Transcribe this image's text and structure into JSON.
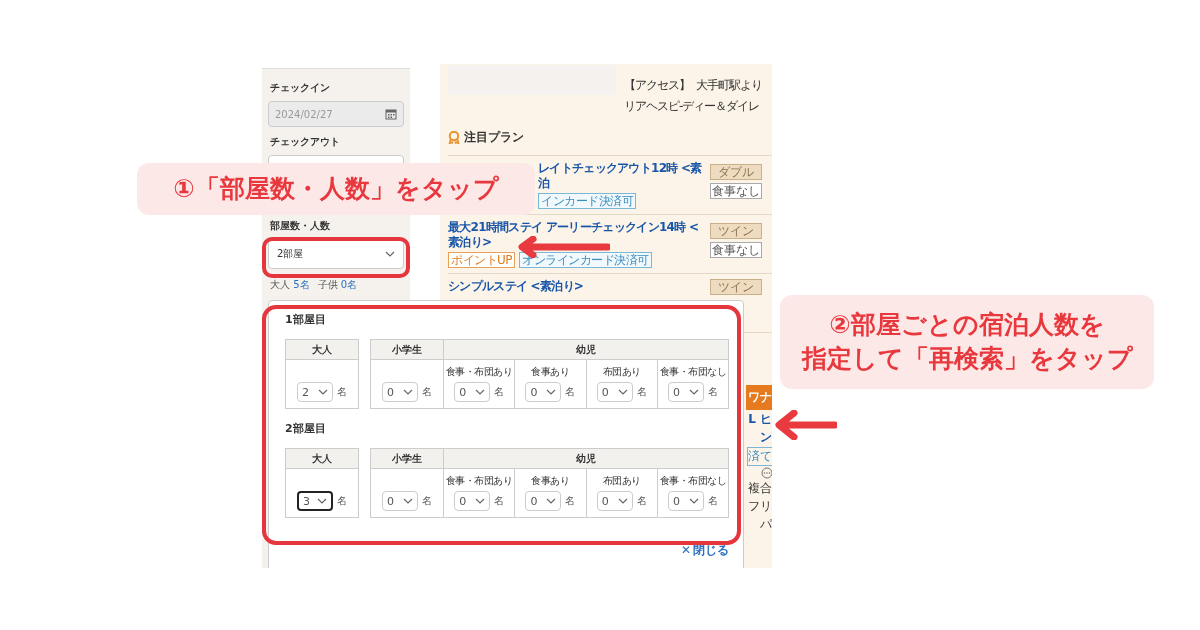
{
  "sidebar": {
    "checkin_label": "チェックイン",
    "checkin_field": {
      "value": "2024/02/27",
      "disabled": true
    },
    "checkout_label": "チェックアウト",
    "rooms_label": "部屋数・人数",
    "rooms_select": "2部屋",
    "summary": [
      {
        "label": "大人",
        "count": "5名"
      },
      {
        "label": "子供",
        "count": "0名"
      }
    ]
  },
  "main": {
    "access_label": "【アクセス】",
    "access_lines": [
      "大手町駅より",
      "リアヘスピ-ディー＆ダイレ"
    ],
    "featured_title": "注目プラン",
    "plans": [
      {
        "title": "レイトチェックアウト12時 <素泊",
        "tags": [
          {
            "text": "インカード決済可",
            "kind": "payment"
          }
        ],
        "room_type": "ダブル",
        "meal": "食事なし"
      },
      {
        "title": "最大21時間ステイ アーリーチェックイン14時 <素泊り>",
        "tags": [
          {
            "text": "ポイントUP",
            "kind": "point"
          },
          {
            "text": "オンラインカード決済可",
            "kind": "payment"
          }
        ],
        "room_type": "ツイン",
        "meal": "食事なし"
      },
      {
        "title": "シンプルステイ <素泊り>",
        "room_type": "ツイン"
      }
    ],
    "edge_fragments": [
      {
        "text": "ワナ",
        "kind": "badge"
      },
      {
        "text": "L ヒ",
        "kind": "link"
      },
      {
        "text": "ン",
        "kind": "link"
      },
      {
        "text": "済て",
        "kind": "tag"
      },
      {
        "kind": "icon"
      },
      {
        "text": "複合",
        "kind": "text"
      },
      {
        "text": "フリ",
        "kind": "text"
      },
      {
        "text": "パ",
        "kind": "text"
      }
    ]
  },
  "guest_popup": {
    "rooms": [
      {
        "title": "1部屋目",
        "adult": {
          "header": "大人",
          "value": "2",
          "focused": false,
          "unit": "名"
        },
        "elementary": {
          "header": "小学生",
          "value": "0",
          "focused": false,
          "unit": "名"
        },
        "infant": {
          "header": "幼児",
          "options": [
            {
              "label": "食事・布団あり",
              "value": "0",
              "focused": false,
              "unit": "名"
            },
            {
              "label": "食事あり",
              "value": "0",
              "focused": false,
              "unit": "名"
            },
            {
              "label": "布団あり",
              "value": "0",
              "focused": false,
              "unit": "名"
            },
            {
              "label": "食事・布団なし",
              "value": "0",
              "focused": false,
              "unit": "名"
            }
          ]
        }
      },
      {
        "title": "2部屋目",
        "adult": {
          "header": "大人",
          "value": "3",
          "focused": true,
          "unit": "名"
        },
        "elementary": {
          "header": "小学生",
          "value": "0",
          "focused": false,
          "unit": "名"
        },
        "infant": {
          "header": "幼児",
          "options": [
            {
              "label": "食事・布団あり",
              "value": "0",
              "focused": false,
              "unit": "名"
            },
            {
              "label": "食事あり",
              "value": "0",
              "focused": false,
              "unit": "名"
            },
            {
              "label": "布団あり",
              "value": "0",
              "focused": false,
              "unit": "名"
            },
            {
              "label": "食事・布団なし",
              "value": "0",
              "focused": false,
              "unit": "名"
            }
          ]
        }
      }
    ],
    "close": {
      "icon": "✕",
      "label": "閉じる"
    }
  },
  "annotations": {
    "callouts": [
      {
        "lines": [
          "①「部屋数・人数」をタップ"
        ]
      },
      {
        "lines": [
          "②部屋ごとの宿泊人数を",
          "指定して「再検索」をタップ"
        ]
      }
    ]
  }
}
